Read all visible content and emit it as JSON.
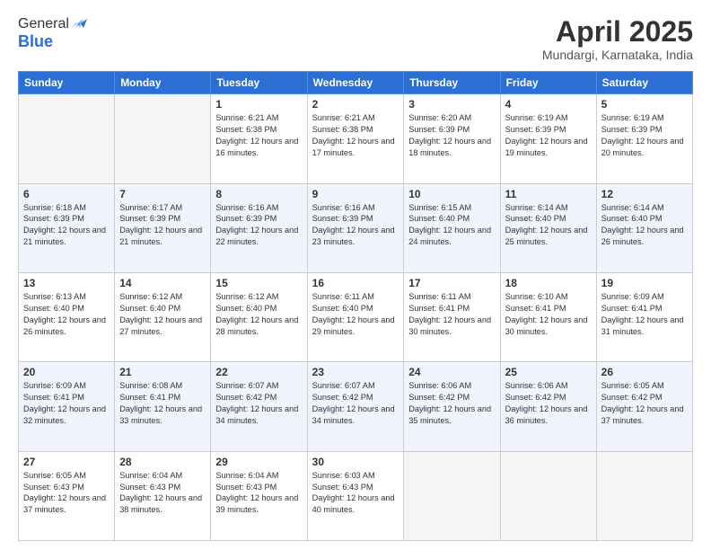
{
  "header": {
    "logo_general": "General",
    "logo_blue": "Blue",
    "month_title": "April 2025",
    "location": "Mundargi, Karnataka, India"
  },
  "days_of_week": [
    "Sunday",
    "Monday",
    "Tuesday",
    "Wednesday",
    "Thursday",
    "Friday",
    "Saturday"
  ],
  "weeks": [
    [
      {
        "day": "",
        "empty": true
      },
      {
        "day": "",
        "empty": true
      },
      {
        "day": "1",
        "sunrise": "Sunrise: 6:21 AM",
        "sunset": "Sunset: 6:38 PM",
        "daylight": "Daylight: 12 hours and 16 minutes."
      },
      {
        "day": "2",
        "sunrise": "Sunrise: 6:21 AM",
        "sunset": "Sunset: 6:38 PM",
        "daylight": "Daylight: 12 hours and 17 minutes."
      },
      {
        "day": "3",
        "sunrise": "Sunrise: 6:20 AM",
        "sunset": "Sunset: 6:39 PM",
        "daylight": "Daylight: 12 hours and 18 minutes."
      },
      {
        "day": "4",
        "sunrise": "Sunrise: 6:19 AM",
        "sunset": "Sunset: 6:39 PM",
        "daylight": "Daylight: 12 hours and 19 minutes."
      },
      {
        "day": "5",
        "sunrise": "Sunrise: 6:19 AM",
        "sunset": "Sunset: 6:39 PM",
        "daylight": "Daylight: 12 hours and 20 minutes."
      }
    ],
    [
      {
        "day": "6",
        "sunrise": "Sunrise: 6:18 AM",
        "sunset": "Sunset: 6:39 PM",
        "daylight": "Daylight: 12 hours and 21 minutes."
      },
      {
        "day": "7",
        "sunrise": "Sunrise: 6:17 AM",
        "sunset": "Sunset: 6:39 PM",
        "daylight": "Daylight: 12 hours and 21 minutes."
      },
      {
        "day": "8",
        "sunrise": "Sunrise: 6:16 AM",
        "sunset": "Sunset: 6:39 PM",
        "daylight": "Daylight: 12 hours and 22 minutes."
      },
      {
        "day": "9",
        "sunrise": "Sunrise: 6:16 AM",
        "sunset": "Sunset: 6:39 PM",
        "daylight": "Daylight: 12 hours and 23 minutes."
      },
      {
        "day": "10",
        "sunrise": "Sunrise: 6:15 AM",
        "sunset": "Sunset: 6:40 PM",
        "daylight": "Daylight: 12 hours and 24 minutes."
      },
      {
        "day": "11",
        "sunrise": "Sunrise: 6:14 AM",
        "sunset": "Sunset: 6:40 PM",
        "daylight": "Daylight: 12 hours and 25 minutes."
      },
      {
        "day": "12",
        "sunrise": "Sunrise: 6:14 AM",
        "sunset": "Sunset: 6:40 PM",
        "daylight": "Daylight: 12 hours and 26 minutes."
      }
    ],
    [
      {
        "day": "13",
        "sunrise": "Sunrise: 6:13 AM",
        "sunset": "Sunset: 6:40 PM",
        "daylight": "Daylight: 12 hours and 26 minutes."
      },
      {
        "day": "14",
        "sunrise": "Sunrise: 6:12 AM",
        "sunset": "Sunset: 6:40 PM",
        "daylight": "Daylight: 12 hours and 27 minutes."
      },
      {
        "day": "15",
        "sunrise": "Sunrise: 6:12 AM",
        "sunset": "Sunset: 6:40 PM",
        "daylight": "Daylight: 12 hours and 28 minutes."
      },
      {
        "day": "16",
        "sunrise": "Sunrise: 6:11 AM",
        "sunset": "Sunset: 6:40 PM",
        "daylight": "Daylight: 12 hours and 29 minutes."
      },
      {
        "day": "17",
        "sunrise": "Sunrise: 6:11 AM",
        "sunset": "Sunset: 6:41 PM",
        "daylight": "Daylight: 12 hours and 30 minutes."
      },
      {
        "day": "18",
        "sunrise": "Sunrise: 6:10 AM",
        "sunset": "Sunset: 6:41 PM",
        "daylight": "Daylight: 12 hours and 30 minutes."
      },
      {
        "day": "19",
        "sunrise": "Sunrise: 6:09 AM",
        "sunset": "Sunset: 6:41 PM",
        "daylight": "Daylight: 12 hours and 31 minutes."
      }
    ],
    [
      {
        "day": "20",
        "sunrise": "Sunrise: 6:09 AM",
        "sunset": "Sunset: 6:41 PM",
        "daylight": "Daylight: 12 hours and 32 minutes."
      },
      {
        "day": "21",
        "sunrise": "Sunrise: 6:08 AM",
        "sunset": "Sunset: 6:41 PM",
        "daylight": "Daylight: 12 hours and 33 minutes."
      },
      {
        "day": "22",
        "sunrise": "Sunrise: 6:07 AM",
        "sunset": "Sunset: 6:42 PM",
        "daylight": "Daylight: 12 hours and 34 minutes."
      },
      {
        "day": "23",
        "sunrise": "Sunrise: 6:07 AM",
        "sunset": "Sunset: 6:42 PM",
        "daylight": "Daylight: 12 hours and 34 minutes."
      },
      {
        "day": "24",
        "sunrise": "Sunrise: 6:06 AM",
        "sunset": "Sunset: 6:42 PM",
        "daylight": "Daylight: 12 hours and 35 minutes."
      },
      {
        "day": "25",
        "sunrise": "Sunrise: 6:06 AM",
        "sunset": "Sunset: 6:42 PM",
        "daylight": "Daylight: 12 hours and 36 minutes."
      },
      {
        "day": "26",
        "sunrise": "Sunrise: 6:05 AM",
        "sunset": "Sunset: 6:42 PM",
        "daylight": "Daylight: 12 hours and 37 minutes."
      }
    ],
    [
      {
        "day": "27",
        "sunrise": "Sunrise: 6:05 AM",
        "sunset": "Sunset: 6:43 PM",
        "daylight": "Daylight: 12 hours and 37 minutes."
      },
      {
        "day": "28",
        "sunrise": "Sunrise: 6:04 AM",
        "sunset": "Sunset: 6:43 PM",
        "daylight": "Daylight: 12 hours and 38 minutes."
      },
      {
        "day": "29",
        "sunrise": "Sunrise: 6:04 AM",
        "sunset": "Sunset: 6:43 PM",
        "daylight": "Daylight: 12 hours and 39 minutes."
      },
      {
        "day": "30",
        "sunrise": "Sunrise: 6:03 AM",
        "sunset": "Sunset: 6:43 PM",
        "daylight": "Daylight: 12 hours and 40 minutes."
      },
      {
        "day": "",
        "empty": true
      },
      {
        "day": "",
        "empty": true
      },
      {
        "day": "",
        "empty": true
      }
    ]
  ]
}
